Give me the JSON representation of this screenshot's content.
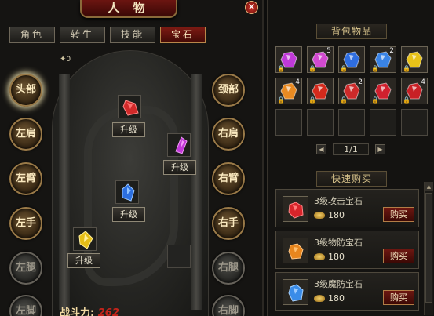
{
  "character": {
    "title": "人 物",
    "tabs": [
      {
        "label": "角色",
        "active": false
      },
      {
        "label": "转生",
        "active": false
      },
      {
        "label": "技能",
        "active": false
      },
      {
        "label": "宝石",
        "active": true
      }
    ],
    "slots_left": [
      {
        "label": "头部",
        "locked": false
      },
      {
        "label": "左肩",
        "locked": false
      },
      {
        "label": "左臂",
        "locked": false
      },
      {
        "label": "左手",
        "locked": false
      },
      {
        "label": "左腿",
        "locked": true
      },
      {
        "label": "左脚",
        "locked": true
      }
    ],
    "slots_right": [
      {
        "label": "颈部",
        "locked": false
      },
      {
        "label": "右肩",
        "locked": false
      },
      {
        "label": "右臂",
        "locked": false
      },
      {
        "label": "右手",
        "locked": false
      },
      {
        "label": "右腿",
        "locked": true
      },
      {
        "label": "右脚",
        "locked": true
      }
    ],
    "upgrade_label": "升级",
    "sparkle_count": "0",
    "power_label": "战斗力:",
    "power_value": "262"
  },
  "bag": {
    "title": "背包物品",
    "items": [
      {
        "color": "#c03ad8",
        "count": "",
        "locked": true
      },
      {
        "color": "#d24ad0",
        "count": "5",
        "locked": true
      },
      {
        "color": "#2f6ee0",
        "count": "",
        "locked": true
      },
      {
        "color": "#3a84e6",
        "count": "2",
        "locked": true
      },
      {
        "color": "#e8c218",
        "count": "",
        "locked": true
      },
      {
        "color": "#e88a22",
        "count": "4",
        "locked": true
      },
      {
        "color": "#d42a1c",
        "count": "",
        "locked": true
      },
      {
        "color": "#cc2a2a",
        "count": "2",
        "locked": true
      },
      {
        "color": "#d0202e",
        "count": "",
        "locked": true
      },
      {
        "color": "#c82026",
        "count": "4",
        "locked": true
      },
      {
        "color": "",
        "count": "",
        "locked": false
      },
      {
        "color": "",
        "count": "",
        "locked": false
      },
      {
        "color": "",
        "count": "",
        "locked": false
      },
      {
        "color": "",
        "count": "",
        "locked": false
      },
      {
        "color": "",
        "count": "",
        "locked": false
      }
    ],
    "page": "1/1",
    "prev_icon": "◀",
    "next_icon": "▶"
  },
  "quick_buy": {
    "title": "快速购买",
    "items": [
      {
        "name": "3级攻击宝石",
        "price": "180",
        "button": "购买",
        "color": "#d8242a"
      },
      {
        "name": "3级物防宝石",
        "price": "180",
        "button": "购买",
        "color": "#e8861e"
      },
      {
        "name": "3级魔防宝石",
        "price": "180",
        "button": "购买",
        "color": "#3a8ce8"
      }
    ]
  },
  "colors": {
    "accent_red": "#7b1a13",
    "gold": "#d9c48c"
  }
}
